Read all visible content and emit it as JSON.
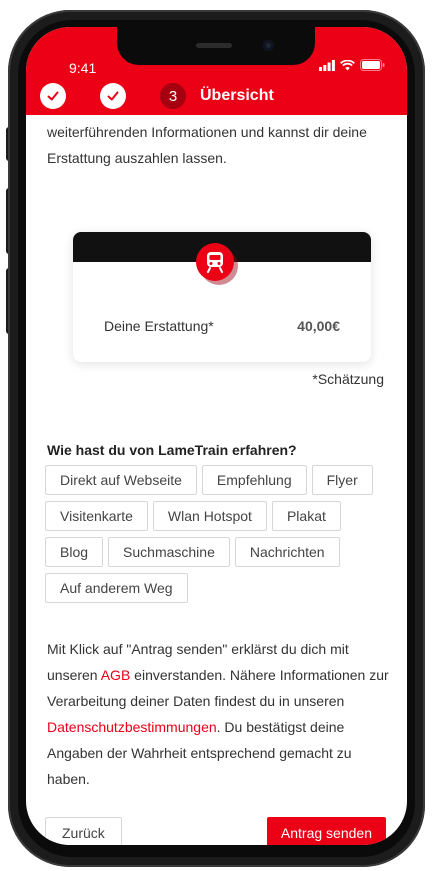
{
  "status_bar": {
    "time": "9:41"
  },
  "header": {
    "steps": [
      {
        "state": "done",
        "icon": "check-icon"
      },
      {
        "state": "done",
        "icon": "check-icon"
      },
      {
        "state": "active",
        "number": "3",
        "label": "Übersicht"
      }
    ],
    "accent_color": "#ec0016"
  },
  "intro_text": "weiterführenden Informationen und kannst dir deine Erstattung auszahlen lassen.",
  "refund": {
    "icon": "train-icon",
    "label": "Deine Erstattung*",
    "value": "40,00€",
    "footnote": "*Schätzung"
  },
  "source_question": {
    "title": "Wie hast du von LameTrain erfahren?",
    "rows": [
      [
        "Direkt auf Webseite",
        "Empfehlung",
        "Flyer"
      ],
      [
        "Visitenkarte",
        "Wlan Hotspot",
        "Plakat"
      ],
      [
        "Blog",
        "Suchmaschine",
        "Nachrichten"
      ],
      [
        "Auf anderem Weg"
      ]
    ]
  },
  "consent": {
    "part1": "Mit Klick auf \"Antrag senden\" erklärst du dich mit unseren ",
    "agb_link": "AGB",
    "part2": " einverstanden. Nähere Informationen zur Verarbeitung deiner Daten findest du in unseren ",
    "privacy_link": "Datenschutzbestimmungen",
    "part3": ". Du bestätigst deine Angaben der Wahrheit entsprechend gemacht zu haben."
  },
  "footer": {
    "back_label": "Zurück",
    "submit_label": "Antrag senden"
  }
}
